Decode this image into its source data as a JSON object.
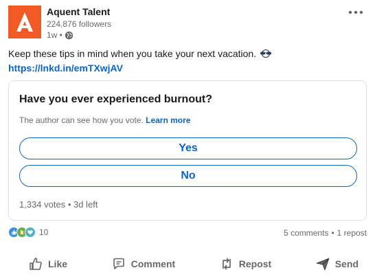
{
  "post": {
    "author": "Aquent Talent",
    "followers": "224,876 followers",
    "time": "1w •",
    "text": "Keep these tips in mind when you take your next vacation.",
    "link": "https://lnkd.in/emTXwjAV"
  },
  "poll": {
    "question": "Have you ever experienced burnout?",
    "note": "The author can see how you vote.",
    "learn_more": "Learn more",
    "options": [
      "Yes",
      "No"
    ],
    "footer": "1,334 votes • 3d left"
  },
  "social": {
    "reaction_count": "10",
    "comments": "5 comments",
    "separator": "•",
    "reposts": "1 repost"
  },
  "actions": {
    "like": "Like",
    "comment": "Comment",
    "repost": "Repost",
    "send": "Send"
  },
  "colors": {
    "brand": "#f15a24",
    "link": "#0a66c2"
  },
  "icons": [
    "more-icon",
    "globe-icon",
    "sunglasses-emoji-icon",
    "like-reaction-icon",
    "celebrate-reaction-icon",
    "support-reaction-icon",
    "like-icon",
    "comment-icon",
    "repost-icon",
    "send-icon"
  ]
}
